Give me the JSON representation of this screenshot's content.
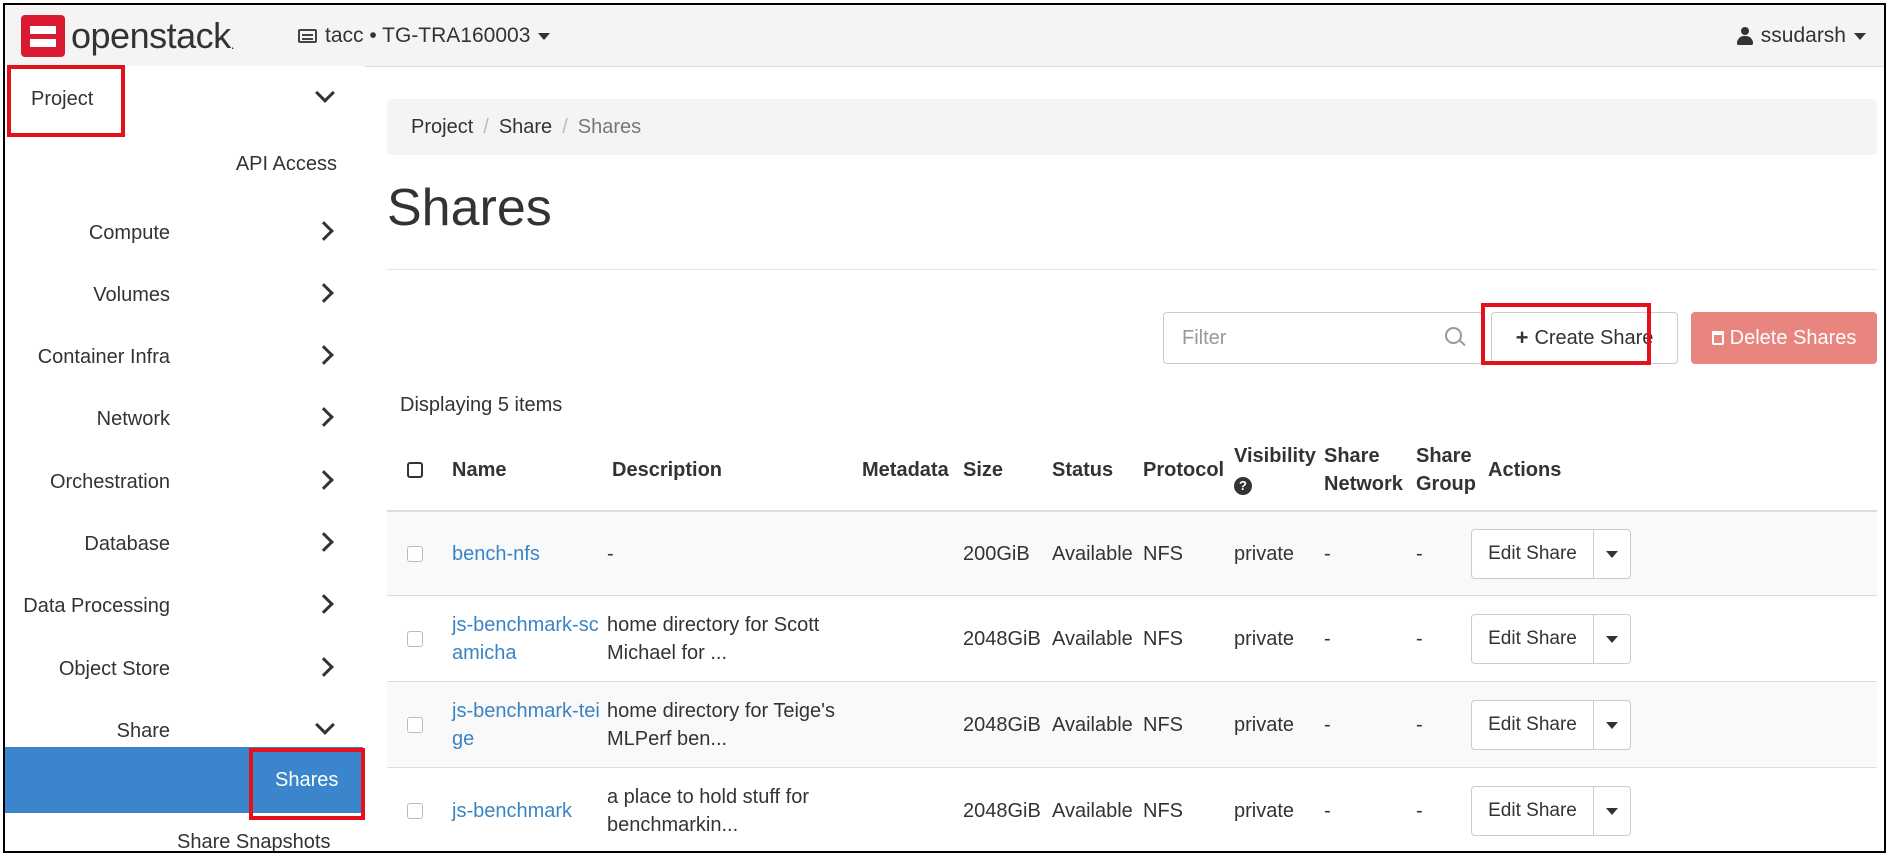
{
  "topbar": {
    "brand": "openstack",
    "project_switcher": "tacc • TG-TRA160003",
    "user": "ssudarsh"
  },
  "sidebar": {
    "project_label": "Project",
    "api_access": "API Access",
    "items": [
      {
        "label": "Compute"
      },
      {
        "label": "Volumes"
      },
      {
        "label": "Container Infra"
      },
      {
        "label": "Network"
      },
      {
        "label": "Orchestration"
      },
      {
        "label": "Database"
      },
      {
        "label": "Data Processing"
      },
      {
        "label": "Object Store"
      },
      {
        "label": "Share"
      }
    ],
    "active_item": "Shares",
    "next_item": "Share Snapshots"
  },
  "breadcrumb": [
    "Project",
    "Share",
    "Shares"
  ],
  "page_title": "Shares",
  "toolbar": {
    "filter_placeholder": "Filter",
    "create_label": "Create Share",
    "delete_label": "Delete Shares"
  },
  "displaying": "Displaying 5 items",
  "table": {
    "headers": {
      "name": "Name",
      "description": "Description",
      "metadata": "Metadata",
      "size": "Size",
      "status": "Status",
      "protocol": "Protocol",
      "visibility": "Visibility",
      "share_network_1": "Share",
      "share_network_2": "Network",
      "share_group_1": "Share",
      "share_group_2": "Group",
      "actions": "Actions"
    },
    "rows": [
      {
        "name": "bench-nfs",
        "name_2": "",
        "desc": "-",
        "desc_2": "",
        "size": "200GiB",
        "status": "Available",
        "protocol": "NFS",
        "visibility": "private",
        "network": "-",
        "group": "-",
        "action": "Edit Share"
      },
      {
        "name": "js-benchmark-sc",
        "name_2": "amicha",
        "desc": "home directory for Scott",
        "desc_2": "Michael for ...",
        "size": "2048GiB",
        "status": "Available",
        "protocol": "NFS",
        "visibility": "private",
        "network": "-",
        "group": "-",
        "action": "Edit Share"
      },
      {
        "name": "js-benchmark-tei",
        "name_2": "ge",
        "desc": "home directory for Teige's",
        "desc_2": "MLPerf ben...",
        "size": "2048GiB",
        "status": "Available",
        "protocol": "NFS",
        "visibility": "private",
        "network": "-",
        "group": "-",
        "action": "Edit Share"
      },
      {
        "name": "js-benchmark",
        "name_2": "",
        "desc": "a place to hold stuff for",
        "desc_2": "benchmarkin...",
        "size": "2048GiB",
        "status": "Available",
        "protocol": "NFS",
        "visibility": "private",
        "network": "-",
        "group": "-",
        "action": "Edit Share"
      }
    ]
  },
  "colors": {
    "accent": "#3b85cc",
    "highlight": "#e4111c",
    "danger": "#e8857f",
    "link": "#3a84c6"
  }
}
